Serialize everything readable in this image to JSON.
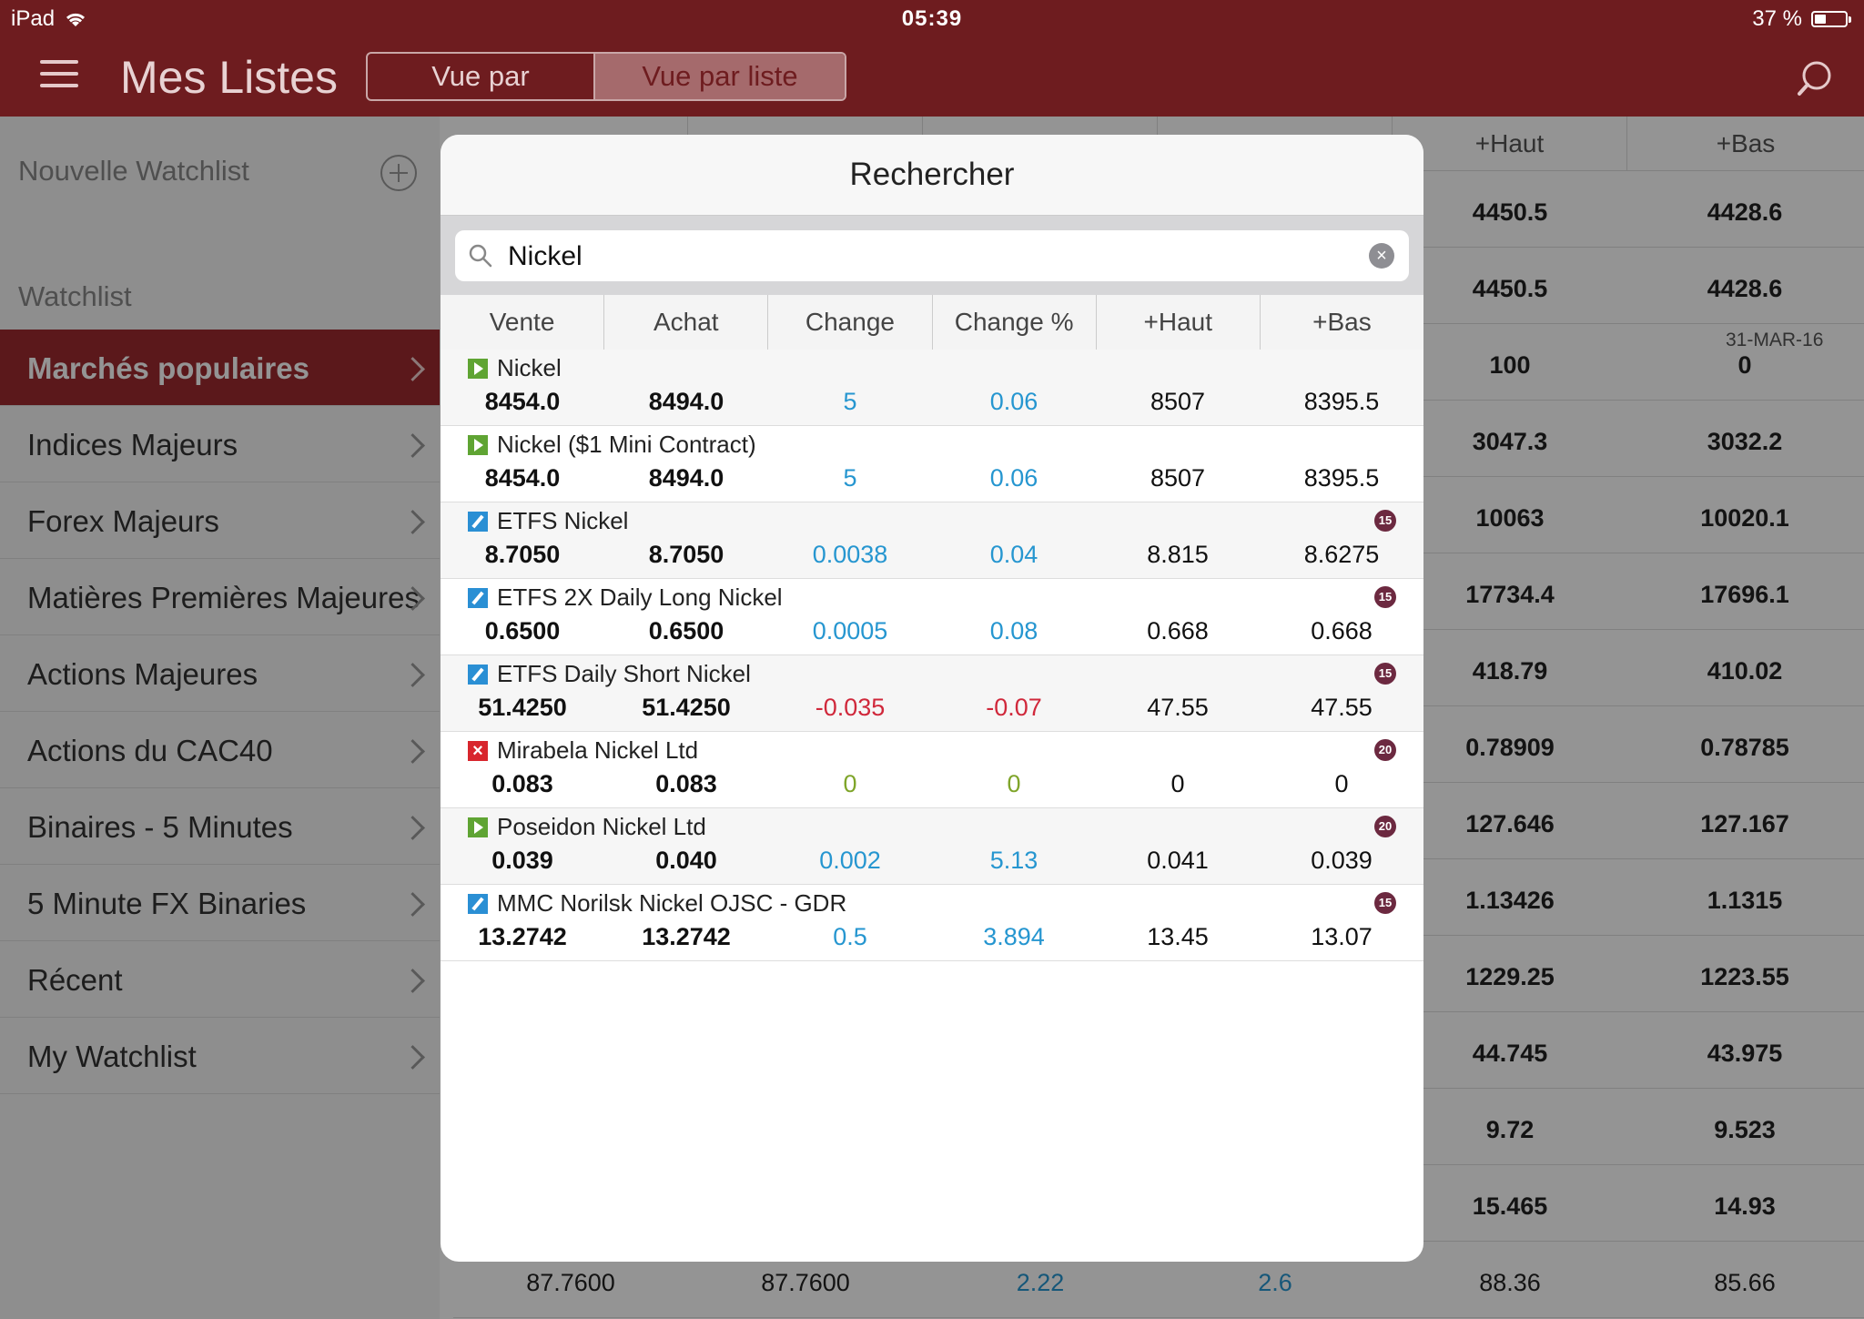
{
  "status_bar": {
    "device": "iPad",
    "time": "05:39",
    "battery": "37 %",
    "battery_level": 0.37
  },
  "nav": {
    "title": "Mes Listes",
    "segment_graph": "Vue par graphique",
    "segment_list": "Vue par liste"
  },
  "sidebar": {
    "new_watchlist": "Nouvelle Watchlist",
    "section": "Watchlist",
    "items": [
      {
        "label": "Marchés populaires",
        "active": true
      },
      {
        "label": "Indices Majeurs"
      },
      {
        "label": "Forex Majeurs"
      },
      {
        "label": "Matières Premières Majeures"
      },
      {
        "label": "Actions Majeures"
      },
      {
        "label": "Actions du CAC40"
      },
      {
        "label": "Binaires - 5 Minutes"
      },
      {
        "label": "5 Minute FX Binaries"
      },
      {
        "label": "Récent"
      },
      {
        "label": "My Watchlist"
      }
    ]
  },
  "background_list": {
    "headers": [
      "+Haut",
      "+Bas"
    ],
    "date_label": "31-MAR-16",
    "rows": [
      [
        "4450.5",
        "4428.6"
      ],
      [
        "4450.5",
        "4428.6"
      ],
      [
        "100",
        "0"
      ],
      [
        "3047.3",
        "3032.2"
      ],
      [
        "10063",
        "10020.1"
      ],
      [
        "17734.4",
        "17696.1"
      ],
      [
        "418.79",
        "410.02"
      ],
      [
        "0.78909",
        "0.78785"
      ],
      [
        "127.646",
        "127.167"
      ],
      [
        "1.13426",
        "1.1315"
      ],
      [
        "1229.25",
        "1223.55"
      ],
      [
        "44.745",
        "43.975"
      ],
      [
        "9.72",
        "9.523"
      ],
      [
        "15.465",
        "14.93"
      ]
    ],
    "last_row": [
      "87.7600",
      "87.7600",
      "2.22",
      "2.6",
      "88.36",
      "85.66"
    ]
  },
  "popup": {
    "title": "Rechercher",
    "search_value": "Nickel",
    "columns": [
      "Vente",
      "Achat",
      "Change",
      "Change %",
      "+Haut",
      "+Bas"
    ],
    "results": [
      {
        "icon": "play-icon",
        "name": "Nickel",
        "badge": "",
        "vente": "8454.0",
        "achat": "8494.0",
        "change": "5",
        "change_pct": "0.06",
        "haut": "8507",
        "bas": "8395.5",
        "tone": "blue"
      },
      {
        "icon": "play-icon",
        "name": "Nickel ($1 Mini Contract)",
        "badge": "",
        "vente": "8454.0",
        "achat": "8494.0",
        "change": "5",
        "change_pct": "0.06",
        "haut": "8507",
        "bas": "8395.5",
        "tone": "blue"
      },
      {
        "icon": "pencil-icon",
        "name": "ETFS Nickel",
        "badge": "15",
        "vente": "8.7050",
        "achat": "8.7050",
        "change": "0.0038",
        "change_pct": "0.04",
        "haut": "8.815",
        "bas": "8.6275",
        "tone": "blue"
      },
      {
        "icon": "pencil-icon",
        "name": "ETFS 2X Daily Long Nickel",
        "badge": "15",
        "vente": "0.6500",
        "achat": "0.6500",
        "change": "0.0005",
        "change_pct": "0.08",
        "haut": "0.668",
        "bas": "0.668",
        "tone": "blue"
      },
      {
        "icon": "pencil-icon",
        "name": "ETFS Daily Short Nickel",
        "badge": "15",
        "vente": "51.4250",
        "achat": "51.4250",
        "change": "-0.035",
        "change_pct": "-0.07",
        "haut": "47.55",
        "bas": "47.55",
        "tone": "red"
      },
      {
        "icon": "cross-icon",
        "name": "Mirabela Nickel Ltd",
        "badge": "20",
        "vente": "0.083",
        "achat": "0.083",
        "change": "0",
        "change_pct": "0",
        "haut": "0",
        "bas": "0",
        "tone": "green"
      },
      {
        "icon": "play-icon",
        "name": "Poseidon Nickel Ltd",
        "badge": "20",
        "vente": "0.039",
        "achat": "0.040",
        "change": "0.002",
        "change_pct": "5.13",
        "haut": "0.041",
        "bas": "0.039",
        "tone": "blue"
      },
      {
        "icon": "pencil-icon",
        "name": "MMC Norilsk Nickel OJSC - GDR",
        "badge": "15",
        "vente": "13.2742",
        "achat": "13.2742",
        "change": "0.5",
        "change_pct": "3.894",
        "haut": "13.45",
        "bas": "13.07",
        "tone": "blue"
      }
    ]
  },
  "colors": {
    "brand": "#6e1c1f",
    "active": "#9e2a2f",
    "positive": "#2696d0",
    "negative": "#d0283b",
    "neutral": "#7fa52a"
  }
}
